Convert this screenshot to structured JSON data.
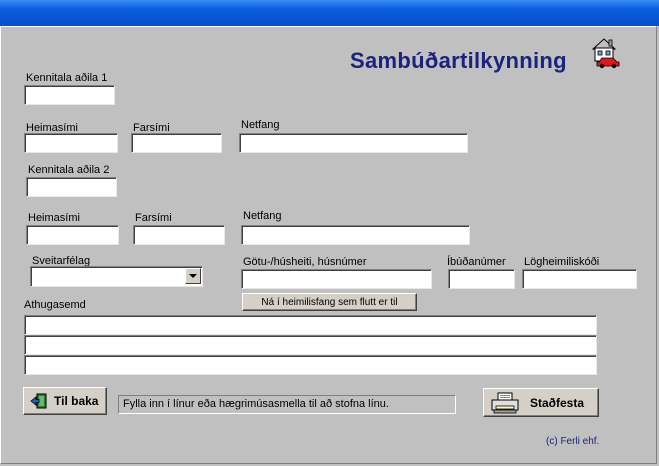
{
  "form": {
    "title": "Sambúðartilkynning",
    "copyright": "(c) Ferli ehf."
  },
  "person1": {
    "kennitala_label": "Kennitala aðila 1",
    "heimasimi_label": "Heimasími",
    "farsimi_label": "Farsími",
    "netfang_label": "Netfang",
    "kennitala_value": "",
    "heimasimi_value": "",
    "farsimi_value": "",
    "netfang_value": ""
  },
  "person2": {
    "kennitala_label": "Kennitala aðila 2",
    "heimasimi_label": "Heimasími",
    "farsimi_label": "Farsími",
    "netfang_label": "Netfang",
    "kennitala_value": "",
    "heimasimi_value": "",
    "farsimi_value": "",
    "netfang_value": ""
  },
  "address": {
    "sveitarfelag_label": "Sveitarfélag",
    "sveitarfelag_value": "",
    "gata_label": "Götu-/húsheiti, húsnúmer",
    "ibud_label": "Íbúðanúmer",
    "logheimili_label": "Lögheimiliskóði",
    "fetch_button_label": "Ná í heimilisfang sem flutt er til"
  },
  "notes": {
    "label": "Athugasemd",
    "lines": [
      "",
      "",
      ""
    ]
  },
  "footer": {
    "back_label": "Til baka",
    "status_text": "Fylla inn í línur eða hægrimúsasmella til að stofna línu.",
    "confirm_label": "Staðfesta"
  },
  "colors": {
    "title_blue": "#1a237e",
    "background": "#c0c0c0",
    "titlebar": "#0a55d6"
  },
  "icons": {
    "house": "house-car-icon",
    "back": "door-exit-icon",
    "confirm": "printer-icon",
    "dropdown": "chevron-down-icon"
  }
}
